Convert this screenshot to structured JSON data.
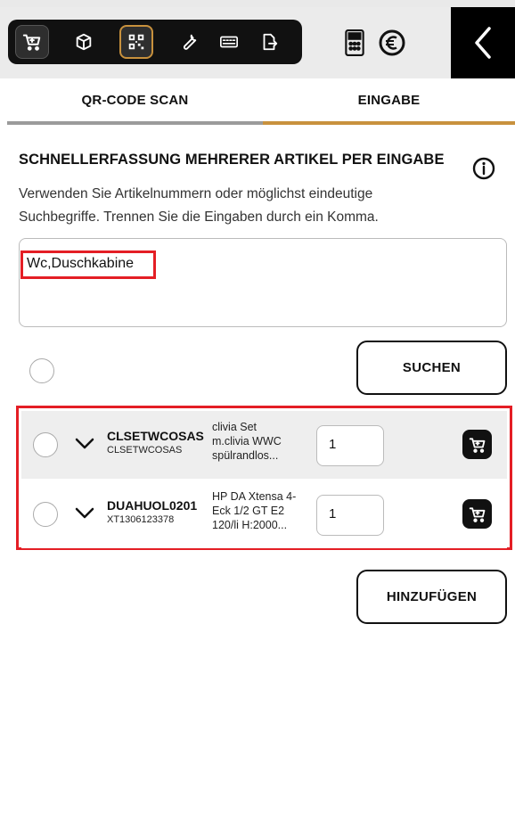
{
  "toolbar": {
    "icons": [
      "cart-icon",
      "box-icon",
      "qr-scan-icon",
      "wrench-icon",
      "keyboard-icon",
      "document-export-icon",
      "calculator-icon",
      "euro-icon",
      "back-chevron-icon"
    ],
    "accent": "#c8913d"
  },
  "tabs": {
    "qr_scan": "QR-CODE SCAN",
    "eingabe": "EINGABE"
  },
  "form": {
    "heading": "SCHNELLERFASSUNG MEHRERER ARTIKEL PER EINGABE",
    "description_line1": "Verwenden Sie Artikelnummern oder möglichst eindeutige",
    "description_line2": "Suchbegriffe. Trennen Sie die Eingaben durch ein Komma.",
    "input_value": "Wc,Duschkabine",
    "search_button": "SUCHEN",
    "add_button": "HINZUFÜGEN"
  },
  "results": [
    {
      "code": "CLSETWCOSAS",
      "subcode": "CLSETWCOSAS",
      "desc_line1": "clivia Set",
      "desc_line2": "m.clivia WWC",
      "desc_line3": "spülrandlos...",
      "qty": "1"
    },
    {
      "code": "DUAHUOL0201",
      "subcode": "XT1306123378",
      "desc_line1": "HP DA Xtensa 4-",
      "desc_line2": "Eck 1/2 GT E2",
      "desc_line3": "120/li H:2000...",
      "qty": "1"
    }
  ],
  "colors": {
    "highlight_red": "#e41e25",
    "tab_active": "#c8913d",
    "tab_inactive": "#9b9b9b"
  }
}
